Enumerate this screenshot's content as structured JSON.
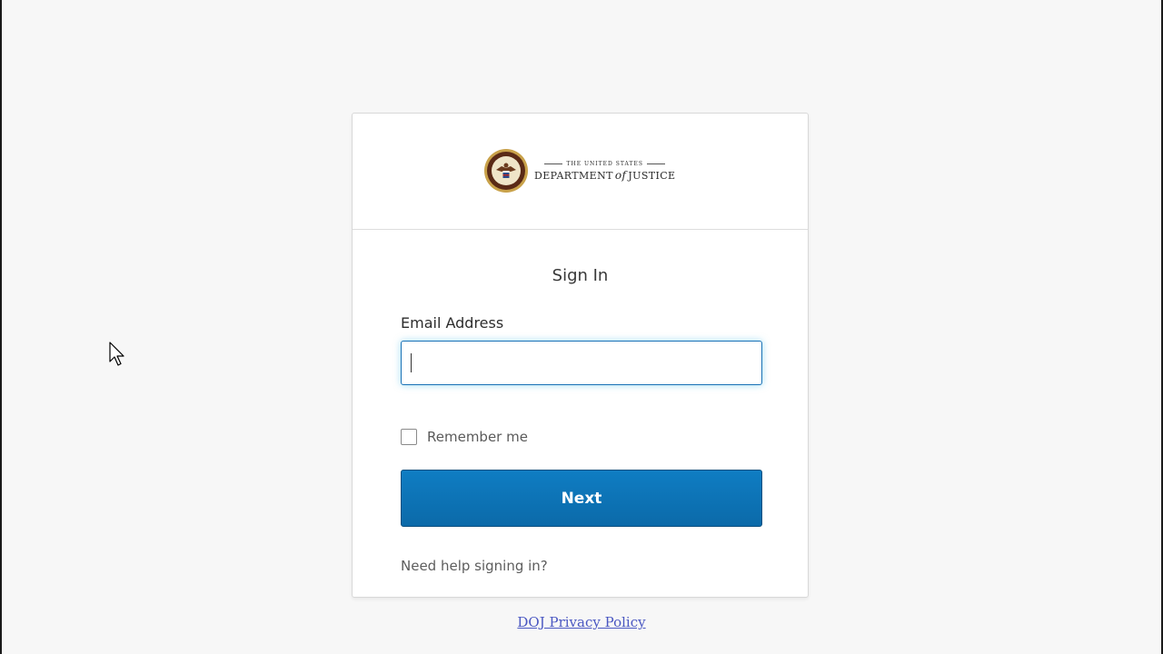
{
  "logo": {
    "line1": "THE UNITED STATES",
    "dept": "DEPARTMENT",
    "of": "of",
    "justice": "JUSTICE"
  },
  "signin": {
    "title": "Sign In",
    "email_label": "Email Address",
    "email_value": "",
    "remember_label": "Remember me",
    "remember_checked": false,
    "next_label": "Next",
    "help_link": "Need help signing in?"
  },
  "footer": {
    "privacy_link": "DOJ Privacy Policy"
  },
  "colors": {
    "page_background": "#f7f7f7",
    "primary_button": "#0b6aa9",
    "input_focus_border": "#1a72b6",
    "link": "#4a57c2"
  },
  "icons": {
    "seal": "doj-seal-icon",
    "cursor": "mouse-pointer-icon"
  }
}
